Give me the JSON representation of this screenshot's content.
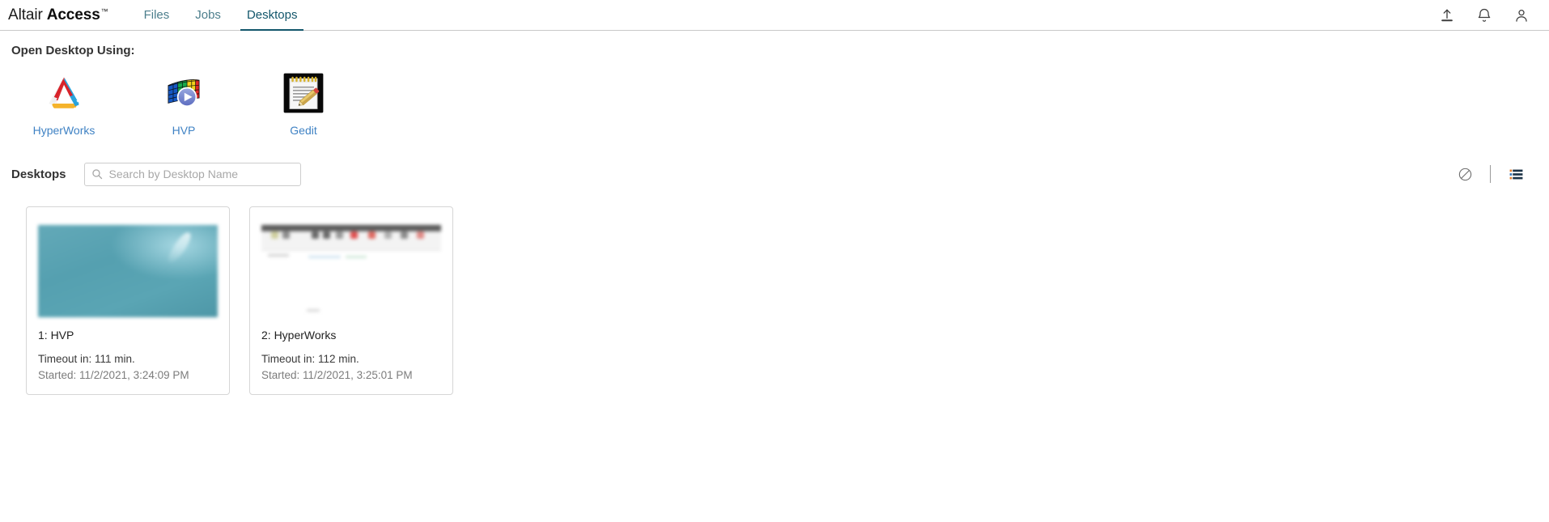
{
  "header": {
    "brand_primary": "Altair",
    "brand_secondary": "Access",
    "brand_tm": "™",
    "tabs": [
      {
        "label": "Files",
        "active": false
      },
      {
        "label": "Jobs",
        "active": false
      },
      {
        "label": "Desktops",
        "active": true
      }
    ],
    "icons": [
      {
        "name": "upload-icon",
        "label": "Upload"
      },
      {
        "name": "bell-icon",
        "label": "Notifications"
      },
      {
        "name": "user-icon",
        "label": "Account"
      }
    ]
  },
  "open_desktop": {
    "title": "Open Desktop Using:",
    "apps": [
      {
        "label": "HyperWorks",
        "icon": "hyperworks-icon"
      },
      {
        "label": "HVP",
        "icon": "hvp-icon"
      },
      {
        "label": "Gedit",
        "icon": "gedit-icon"
      }
    ]
  },
  "desktops_section": {
    "heading": "Desktops",
    "search": {
      "value": "",
      "placeholder": "Search by Desktop Name"
    },
    "toolbar": [
      {
        "name": "disable-icon",
        "label": "Disconnect All"
      },
      {
        "name": "list-view-icon",
        "label": "List View"
      }
    ]
  },
  "desktops": [
    {
      "title": "1: HVP",
      "timeout": "Timeout in: 111 min.",
      "started": "Started: 11/2/2021, 3:24:09 PM",
      "thumb": "teal"
    },
    {
      "title": "2: HyperWorks",
      "timeout": "Timeout in: 112 min.",
      "started": "Started: 11/2/2021, 3:25:01 PM",
      "thumb": "white"
    }
  ],
  "colors": {
    "accent": "#12566b",
    "tab_inactive": "#4c7e8c",
    "link": "#3f82c4",
    "border": "#d6d6d6",
    "thumb_teal": "#55a0b0"
  }
}
